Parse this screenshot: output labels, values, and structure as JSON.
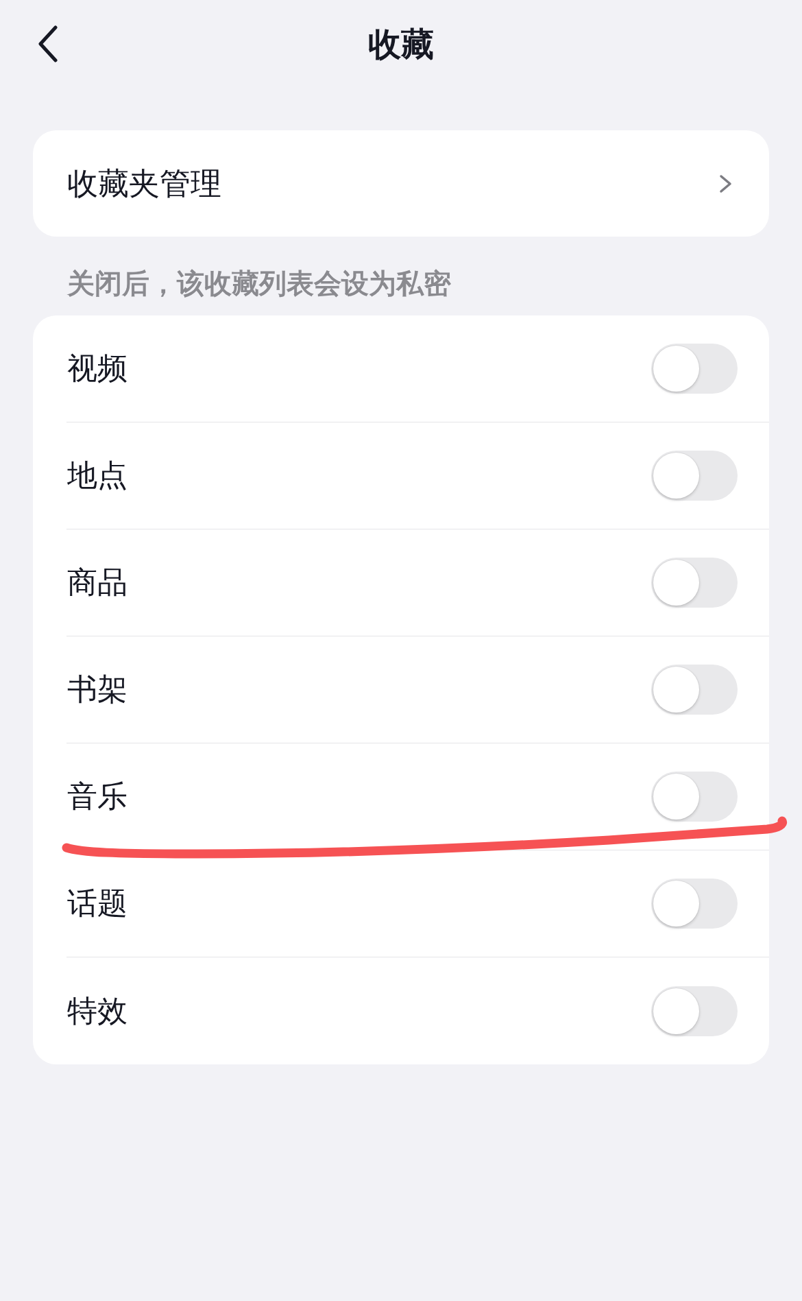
{
  "header": {
    "title": "收藏"
  },
  "manage_item": {
    "label": "收藏夹管理"
  },
  "hint": "关闭后，该收藏列表会设为私密",
  "categories": [
    {
      "label": "视频",
      "on": false,
      "underlined": false
    },
    {
      "label": "地点",
      "on": false,
      "underlined": false
    },
    {
      "label": "商品",
      "on": false,
      "underlined": false
    },
    {
      "label": "书架",
      "on": false,
      "underlined": false
    },
    {
      "label": "音乐",
      "on": false,
      "underlined": true
    },
    {
      "label": "话题",
      "on": false,
      "underlined": false
    },
    {
      "label": "特效",
      "on": false,
      "underlined": false
    }
  ]
}
